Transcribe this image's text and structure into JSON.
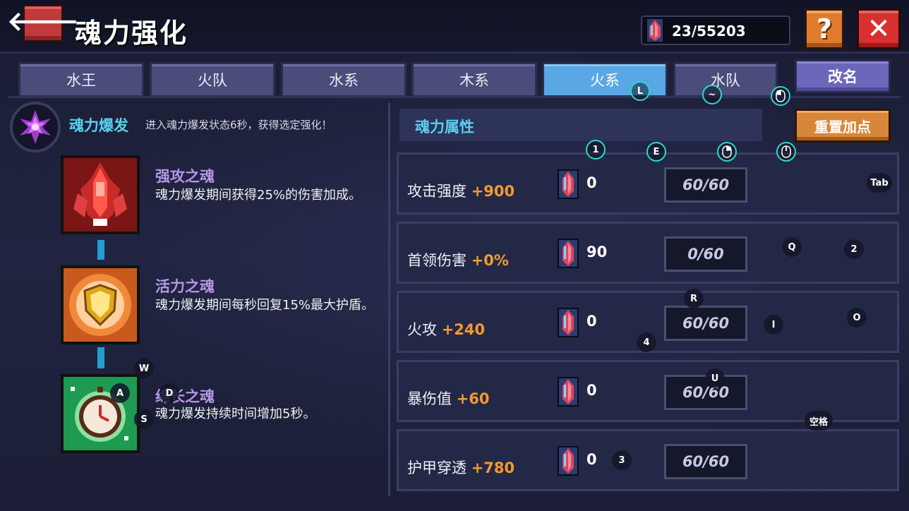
{
  "header": {
    "title": "魂力强化",
    "currency": "23/55203",
    "help_label": "?",
    "close_label": "✕",
    "back_label": "🡐"
  },
  "tabs": [
    {
      "label": "水王",
      "active": false
    },
    {
      "label": "火队",
      "active": false
    },
    {
      "label": "水系",
      "active": false
    },
    {
      "label": "木系",
      "active": false
    },
    {
      "label": "火系",
      "active": true
    },
    {
      "label": "水队",
      "active": false
    }
  ],
  "rename_label": "改名",
  "burst": {
    "title": "魂力爆发",
    "desc": "进入魂力爆发状态6秒，获得选定强化！"
  },
  "skills": [
    {
      "name": "强攻之魂",
      "desc": "魂力爆发期间获得25%的伤害加成。",
      "icon": "red-rocket-icon"
    },
    {
      "name": "活力之魂",
      "desc": "魂力爆发期间每秒回复15%最大护盾。",
      "icon": "gold-shield-icon"
    },
    {
      "name": "绵长之魂",
      "desc": "魂力爆发持续时间增加5秒。",
      "icon": "green-stopwatch-icon"
    }
  ],
  "attributes": {
    "title": "魂力属性",
    "reset_label": "重置加点",
    "rows": [
      {
        "name": "攻击强度",
        "bonus": "+900",
        "cost": "0",
        "level": "60/60"
      },
      {
        "name": "首领伤害",
        "bonus": "+0%",
        "cost": "90",
        "level": "0/60"
      },
      {
        "name": "火攻",
        "bonus": "+240",
        "cost": "0",
        "level": "60/60"
      },
      {
        "name": "暴伤值",
        "bonus": "+60",
        "cost": "0",
        "level": "60/60"
      },
      {
        "name": "护甲穿透",
        "bonus": "+780",
        "cost": "0",
        "level": "60/60"
      }
    ]
  },
  "key_hints": {
    "L": "L",
    "tilde": "~",
    "one": "1",
    "E": "E",
    "tab": "Tab",
    "Q": "Q",
    "two": "2",
    "R": "R",
    "I": "I",
    "O": "O",
    "four": "4",
    "U": "U",
    "W": "W",
    "A": "A",
    "D": "D",
    "S": "S",
    "space": "空格",
    "three": "3"
  },
  "colors": {
    "accent_cyan": "#5ad0f0",
    "bonus_orange": "#f29a2e",
    "tab_active": "#5aa7e6",
    "skill_name": "#b695e6"
  }
}
